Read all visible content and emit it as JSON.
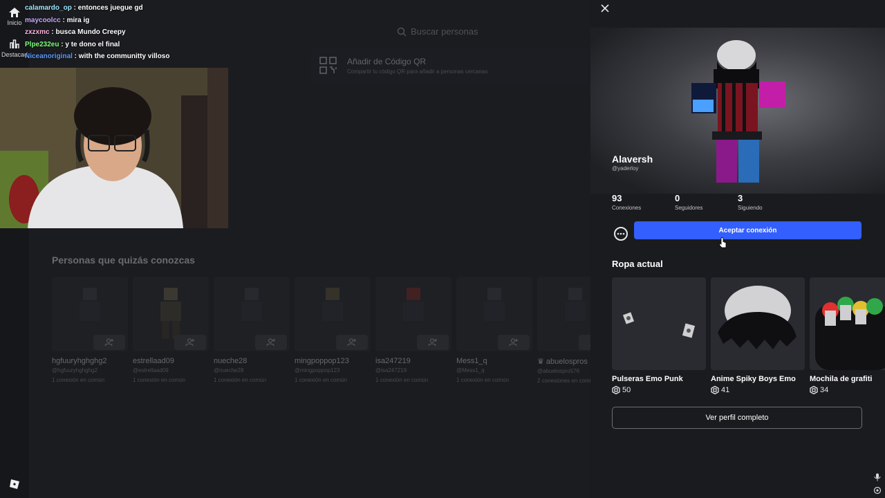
{
  "sidebar": {
    "items": [
      {
        "label": "Inicio",
        "icon": "home-icon"
      },
      {
        "label": "Destacad",
        "icon": "chart-icon"
      }
    ],
    "logo_icon": "roblox-logo-icon"
  },
  "main": {
    "search_placeholder": "Buscar personas",
    "qr_title": "Añadir de Código QR",
    "qr_subtitle": "Compartir tu código QR para añadir a personas cercanas",
    "people_heading": "Personas que quizás conozcas",
    "people": [
      {
        "name": "hgfuuryhghghg2",
        "username": "@hgfuuryhghghg2",
        "meta": "1 conexión en común"
      },
      {
        "name": "estrellaad09",
        "username": "@estrellaad09",
        "meta": "1 conexión en común"
      },
      {
        "name": "nueche28",
        "username": "@nueche28",
        "meta": "1 conexión en común"
      },
      {
        "name": "mingpoppop123",
        "username": "@mingpoppop123",
        "meta": "1 conexión en común"
      },
      {
        "name": "isa247219",
        "username": "@isa247219",
        "meta": "1 conexión en común"
      },
      {
        "name": "Mess1_q",
        "username": "@Mess1_q",
        "meta": "1 conexión en común"
      },
      {
        "name": "♛ abuelospros",
        "username": "@abuelospro576",
        "meta": "2 conexiones en común"
      }
    ]
  },
  "chat": {
    "lines": [
      {
        "user": "calamardo_op",
        "text": "entonces juegue gd",
        "color": "#9fe8ff"
      },
      {
        "user": "maycoolcc",
        "text": "mira ig",
        "color": "#c7a9ff"
      },
      {
        "user": "zxzxmc",
        "text": "busca Mundo Creepy",
        "color": "#ffb3e0"
      },
      {
        "user": "Plpe232eu",
        "text": "y te dono el final",
        "color": "#7dff7a"
      },
      {
        "user": "Niceanoriginal",
        "text": "with the communitty villoso",
        "color": "#5a9cff"
      }
    ]
  },
  "profile": {
    "display_name": "Alaversh",
    "username": "@yaderloy",
    "stats": [
      {
        "value": "93",
        "label": "Conexiones"
      },
      {
        "value": "0",
        "label": "Seguidores"
      },
      {
        "value": "3",
        "label": "Siguiendo"
      }
    ],
    "accept_label": "Aceptar conexión",
    "outfit_title": "Ropa actual",
    "items": [
      {
        "name": "Pulseras Emo Punk",
        "price": "50"
      },
      {
        "name": "Anime Spiky Boys Emo",
        "price": "41"
      },
      {
        "name": "Mochila de grafiti",
        "price": "34"
      }
    ],
    "full_profile_label": "Ver perfil completo"
  },
  "colors": {
    "accent": "#335fff",
    "panel_bg": "#1a1b1e",
    "main_bg": "#1b1c20"
  }
}
